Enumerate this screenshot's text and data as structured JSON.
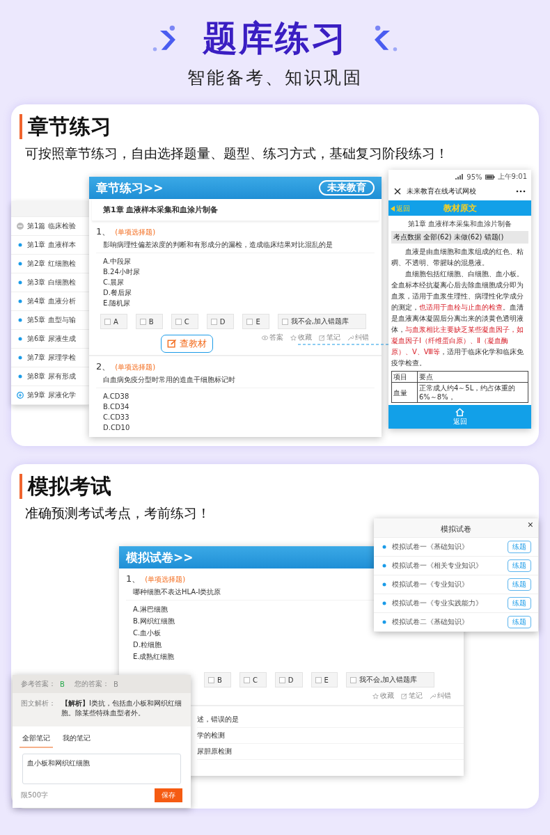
{
  "header": {
    "title": "题库练习",
    "subtitle": "智能备考、知识巩固"
  },
  "chapter_section": {
    "title": "章节练习",
    "description": "可按照章节练习，自由选择题量、题型、练习方式，基础复习阶段练习！",
    "chapter_list": [
      {
        "label": "第1篇 临床检验",
        "kind": "collapse"
      },
      {
        "label": "第1章 血液样本",
        "kind": "chapter"
      },
      {
        "label": "第2章 红细胞检",
        "kind": "chapter"
      },
      {
        "label": "第3章 白细胞检",
        "kind": "chapter"
      },
      {
        "label": "第4章 血液分析",
        "kind": "chapter"
      },
      {
        "label": "第5章 血型与输",
        "kind": "chapter"
      },
      {
        "label": "第6章 尿液生成",
        "kind": "chapter"
      },
      {
        "label": "第7章 尿理学检",
        "kind": "chapter"
      },
      {
        "label": "第8章 尿有形成",
        "kind": "chapter"
      },
      {
        "label": "第9章 尿液化学",
        "kind": "expand"
      }
    ],
    "practice_window": {
      "banner": "章节练习>>",
      "brand": "未来教育",
      "chapter_title": "第1章 血液样本采集和血涂片制备",
      "questions": [
        {
          "number": "1、",
          "type": "(单项选择题)",
          "text": "影响病理性偏差浓度的判断和有形成分的漏检，造成临床结果对比混乱的是",
          "options": [
            "A.中段尿",
            "B.24小时尿",
            "C.晨尿",
            "D.餐后尿",
            "E.随机尿"
          ],
          "answer_buttons": [
            "A",
            "B",
            "C",
            "D",
            "E"
          ],
          "unsure_button": "我不会,加入错题库",
          "actions": [
            {
              "label": "答案",
              "kind": "answer"
            },
            {
              "label": "收藏",
              "kind": "favorite"
            },
            {
              "label": "笔记",
              "kind": "note"
            },
            {
              "label": "纠错",
              "kind": "report"
            }
          ]
        },
        {
          "number": "2、",
          "type": "(单项选择题)",
          "text": "白血病免疫分型时常用的造血干细胞标记时",
          "options": [
            "A.CD38",
            "B.CD34",
            "C.CD33",
            "D.CD10"
          ]
        }
      ]
    },
    "textbook_button": "查教材",
    "phone": {
      "battery": "95%",
      "time": "上午9:01",
      "title": "未来教育在线考试网校",
      "back": "返回",
      "header": "教材原文",
      "chapter": "第1章 血液样本采集和血涂片制备",
      "stats": "考点数据 全部(62) 未做(62) 错题()",
      "paragraphs": [
        "血液是由血细胞和血浆组成的红色、粘稠、不透明、带腥味的混悬液。",
        "血细胞包括红细胞、白细胞、血小板。全血标本经抗凝离心后去除血细胞成分即为血浆，适用于血浆生理性、病理性化学成分的测定，**也适用于血栓与止血的检查**。血清是血液离体凝固后分离出来的淡黄色透明液体，**与血浆相比主要缺乏某些凝血因子，如凝血因子Ⅰ（纤维蛋白原）、Ⅱ（凝血酶原）、Ⅴ、Ⅷ等**，适用于临床化学和临床免疫学检查。"
      ],
      "table": {
        "columns": [
          "项目",
          "要点"
        ],
        "rows": [
          [
            "血量",
            "正常成人约4～5L，约占体重的6%～8%，"
          ]
        ]
      },
      "nav_label": "返回"
    }
  },
  "exam_section": {
    "title": "模拟考试",
    "description": "准确预测考试考点，考前练习！",
    "paper_list": {
      "title": "模拟试卷",
      "close": "×",
      "items": [
        {
          "label": "模拟试卷一《基础知识》",
          "button": "练题"
        },
        {
          "label": "模拟试卷一《相关专业知识》",
          "button": "练题"
        },
        {
          "label": "模拟试卷一《专业知识》",
          "button": "练题"
        },
        {
          "label": "模拟试卷一《专业实践能力》",
          "button": "练题"
        },
        {
          "label": "模拟试卷二《基础知识》",
          "button": "练题"
        }
      ]
    },
    "exam_window": {
      "banner": "模拟试卷>>",
      "number": "1、",
      "type": "(单项选择题)",
      "text": "哪种细胞不表达HLA-Ⅰ类抗原",
      "options": [
        "A.淋巴细胞",
        "B.网织红细胞",
        "C.血小板",
        "D.粒细胞",
        "E.成熟红细胞"
      ],
      "answer_buttons": [
        "B",
        "C",
        "D",
        "E"
      ],
      "unsure_button": "我不会,加入错题库",
      "actions": [
        {
          "label": "收藏",
          "kind": "favorite"
        },
        {
          "label": "笔记",
          "kind": "note"
        },
        {
          "label": "纠错",
          "kind": "report"
        }
      ],
      "next_question_fragments": [
        "述，错误的是",
        "学的检测",
        "尿胆原检测"
      ]
    },
    "analysis_panel": {
      "reference_label": "参考答案：",
      "reference_value": "B",
      "your_label": "您的答案：",
      "your_value": "B",
      "analysis_label": "图文解析：",
      "analysis_text": "**【解析】**Ⅰ类抗，包括血小板和网织红细胞。除某些特殊血型者外。",
      "note_tabs": [
        {
          "label": "全部笔记",
          "selected": true
        },
        {
          "label": "我的笔记",
          "selected": false
        }
      ],
      "note_text": "血小板和网织红细胞",
      "limit": "限500字",
      "save": "保存"
    }
  }
}
